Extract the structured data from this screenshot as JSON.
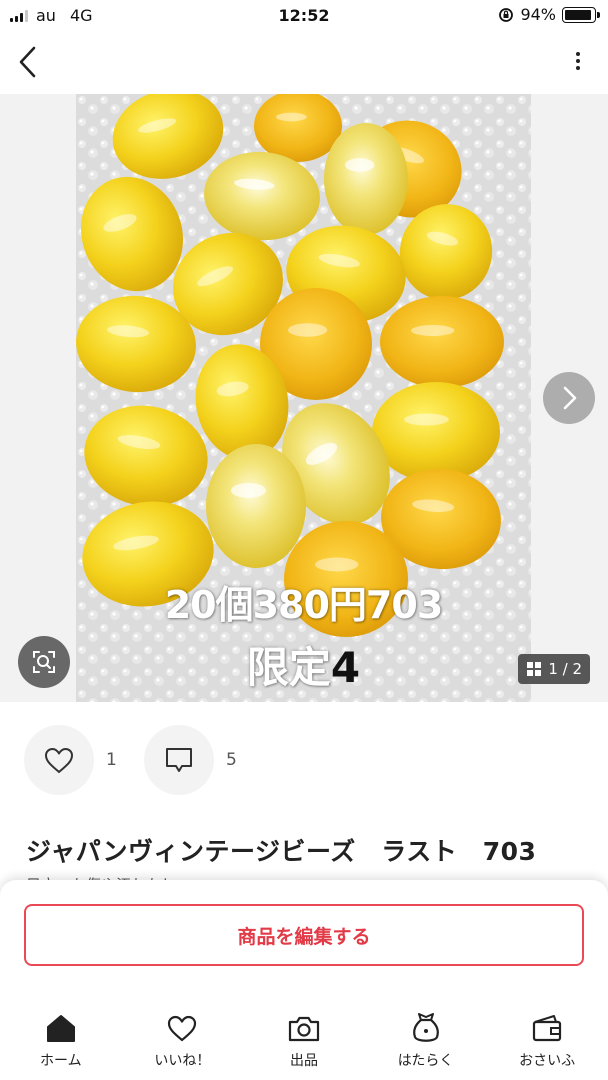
{
  "status_bar": {
    "carrier": "au",
    "network": "4G",
    "time": "12:52",
    "battery": "94%",
    "battery_level": 0.94
  },
  "gallery": {
    "caption_line1": "20個380円703",
    "caption_line2_prefix": "限定",
    "caption_line2_number": "4",
    "counter": "1 / 2"
  },
  "actions": {
    "like_count": "1",
    "comment_count": "5"
  },
  "item": {
    "title": "ジャパンヴィンテージビーズ　ラスト　703",
    "description": "目立った傷や汚れなし"
  },
  "edit_button_label": "商品を編集する",
  "tabbar": {
    "items": [
      {
        "label": "ホーム",
        "icon": "home-icon"
      },
      {
        "label": "いいね！",
        "icon": "heart-icon"
      },
      {
        "label": "出品",
        "icon": "camera-icon"
      },
      {
        "label": "はたらく",
        "icon": "money-bag-icon"
      },
      {
        "label": "おさいふ",
        "icon": "wallet-icon"
      }
    ]
  }
}
